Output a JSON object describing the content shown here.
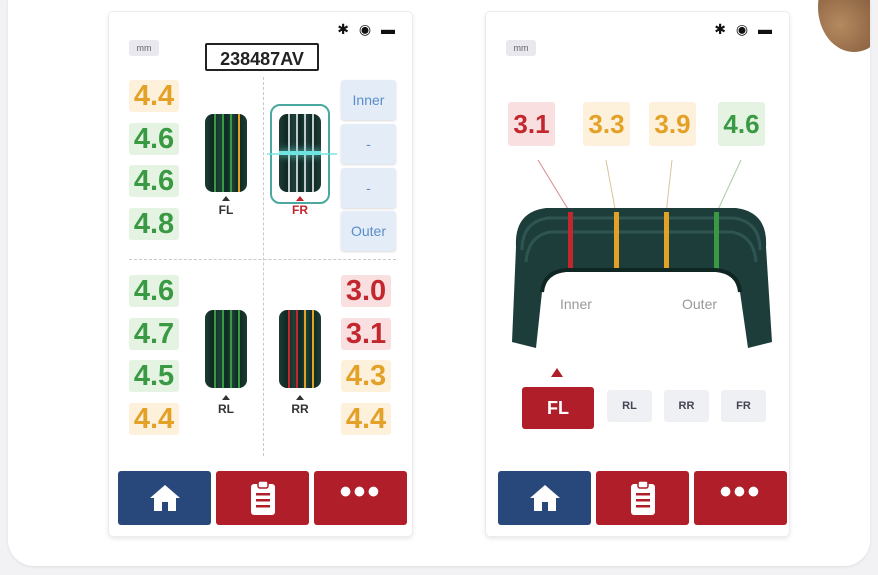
{
  "screen_left": {
    "status_icons": "✱ ◉ ▬",
    "unit": "mm",
    "vehicle_id": "238487AV",
    "wheels": {
      "FL": {
        "label": "FL",
        "values": [
          "4.4",
          "4.6",
          "4.6",
          "4.8"
        ]
      },
      "FR": {
        "label": "FR"
      },
      "RL": {
        "label": "RL",
        "values": [
          "4.6",
          "4.7",
          "4.5",
          "4.4"
        ]
      },
      "RR": {
        "label": "RR",
        "values": [
          "3.0",
          "3.1",
          "4.3",
          "4.4"
        ]
      }
    },
    "position_buttons": [
      "Inner",
      "-",
      "-",
      "Outer"
    ],
    "nav": {
      "home_icon": "home-icon",
      "report_icon": "clipboard-icon",
      "more_label": "•••"
    }
  },
  "screen_right": {
    "status_icons": "✱ ◉ ▬",
    "unit": "mm",
    "profile_values": [
      "3.1",
      "3.3",
      "3.9",
      "4.6"
    ],
    "inner_label": "Inner",
    "outer_label": "Outer",
    "wheel_buttons": [
      "FL",
      "RL",
      "RR",
      "FR"
    ],
    "selected_wheel": "FL",
    "nav": {
      "home_icon": "home-icon",
      "report_icon": "clipboard-icon",
      "more_label": "•••"
    }
  },
  "colors": {
    "good": "#3a9a43",
    "warn": "#e4a128",
    "bad": "#c3272e",
    "nav_blue": "#28477b",
    "nav_red": "#b01e2a",
    "accent_blue": "#5a8cc9"
  }
}
